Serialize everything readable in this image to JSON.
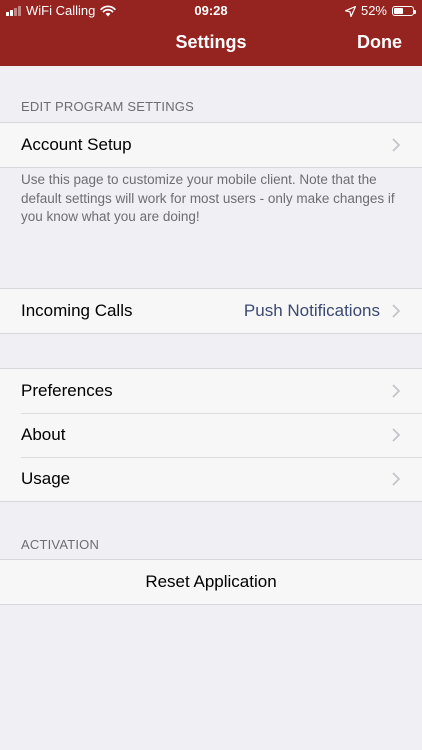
{
  "status_bar": {
    "carrier": "WiFi Calling",
    "time": "09:28",
    "battery_percent": "52%",
    "battery_level": 0.52
  },
  "nav": {
    "title": "Settings",
    "done_label": "Done"
  },
  "sections": {
    "edit_program": {
      "header": "EDIT PROGRAM SETTINGS",
      "account_setup": "Account Setup",
      "footer": "Use this page to customize your mobile client. Note that the default settings will work for most users - only make changes if you know what you are doing!"
    },
    "incoming": {
      "label": "Incoming Calls",
      "value": "Push Notifications"
    },
    "misc": {
      "preferences": "Preferences",
      "about": "About",
      "usage": "Usage"
    },
    "activation": {
      "header": "ACTIVATION",
      "reset": "Reset Application"
    }
  },
  "colors": {
    "nav_background": "#95231f",
    "page_background": "#efeff4",
    "value_text": "#3b4a73"
  },
  "icons": [
    "signal-icon",
    "wifi-icon",
    "location-arrow-icon",
    "battery-icon",
    "chevron-right-icon"
  ]
}
